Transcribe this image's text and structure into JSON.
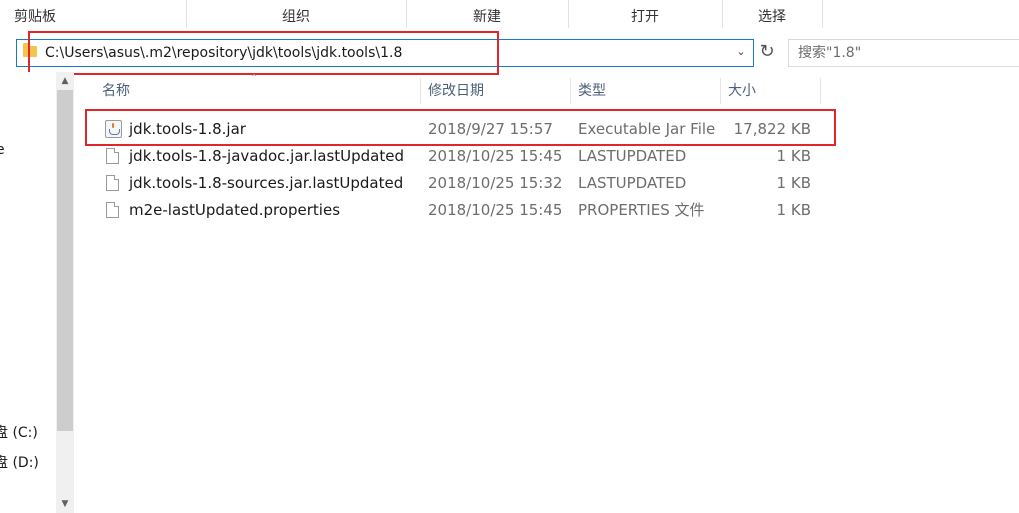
{
  "ribbon": {
    "groups": [
      "剪贴板",
      "组织",
      "新建",
      "打开",
      "选择"
    ]
  },
  "address": {
    "path": "C:\\Users\\asus\\.m2\\repository\\jdk\\tools\\jdk.tools\\1.8",
    "search_placeholder": "搜索\"1.8\""
  },
  "nav": {
    "items": [
      "e",
      "盘 (C:)",
      "盘 (D:)",
      ")"
    ]
  },
  "columns": {
    "name": "名称",
    "date": "修改日期",
    "type": "类型",
    "size": "大小"
  },
  "files": [
    {
      "name": "jdk.tools-1.8.jar",
      "date": "2018/9/27 15:57",
      "type": "Executable Jar File",
      "size": "17,822 KB",
      "icon": "jar-file-icon"
    },
    {
      "name": "jdk.tools-1.8-javadoc.jar.lastUpdated",
      "date": "2018/10/25 15:45",
      "type": "LASTUPDATED",
      "size": "1 KB",
      "icon": "file-icon"
    },
    {
      "name": "jdk.tools-1.8-sources.jar.lastUpdated",
      "date": "2018/10/25 15:32",
      "type": "LASTUPDATED",
      "size": "1 KB",
      "icon": "file-icon"
    },
    {
      "name": "m2e-lastUpdated.properties",
      "date": "2018/10/25 15:45",
      "type": "PROPERTIES 文件",
      "size": "1 KB",
      "icon": "file-icon"
    }
  ],
  "colors": {
    "highlight": "#e0262a",
    "accent": "#1979ca"
  }
}
